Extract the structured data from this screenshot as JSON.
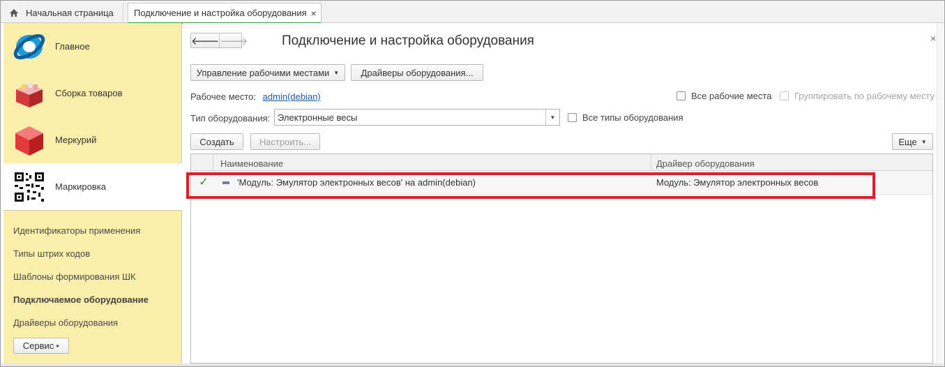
{
  "tabs": {
    "home_label": "Начальная страница",
    "active_label": "Подключение и настройка оборудования",
    "close_glyph": "×"
  },
  "sidebar": {
    "sections": [
      {
        "label": "Главное",
        "icon": "main-globe-icon"
      },
      {
        "label": "Сборка товаров",
        "icon": "goods-crate-icon"
      },
      {
        "label": "Меркурий",
        "icon": "mercury-cube-icon"
      },
      {
        "label": "Маркировка",
        "icon": "qr-code-icon"
      }
    ],
    "links": [
      "Идентификаторы применения",
      "Типы штрих кодов",
      "Шаблоны формирования ШК",
      "Подключаемое оборудование",
      "Драйверы оборудования"
    ],
    "service_button": "Сервис"
  },
  "main": {
    "title": "Подключение и настройка оборудования",
    "manage_workplaces_button": "Управление рабочими местами",
    "drivers_button": "Драйверы оборудования...",
    "workplace_label": "Рабочее место:",
    "workplace_value": "admin(debian)",
    "all_workplaces_label": "Все рабочие места",
    "group_by_workplace_label": "Группировать по рабочему месту",
    "equipment_type_label": "Тип оборудования:",
    "equipment_type_value": "Электронные весы",
    "all_types_label": "Все типы оборудования",
    "create_button": "Создать",
    "configure_button": "Настроить...",
    "more_button": "Еще"
  },
  "table": {
    "columns": [
      "Наименование",
      "Драйвер оборудования"
    ],
    "rows": [
      {
        "name": "'Модуль: Эмулятор электронных весов' на admin(debian)",
        "driver": "Модуль: Эмулятор электронных весов",
        "enabled": true
      }
    ]
  },
  "colors": {
    "sidebar_bg": "#faeeaa",
    "highlight": "#e01e26",
    "active_tab_underline": "#36a038",
    "check": "#2c9a2c"
  }
}
